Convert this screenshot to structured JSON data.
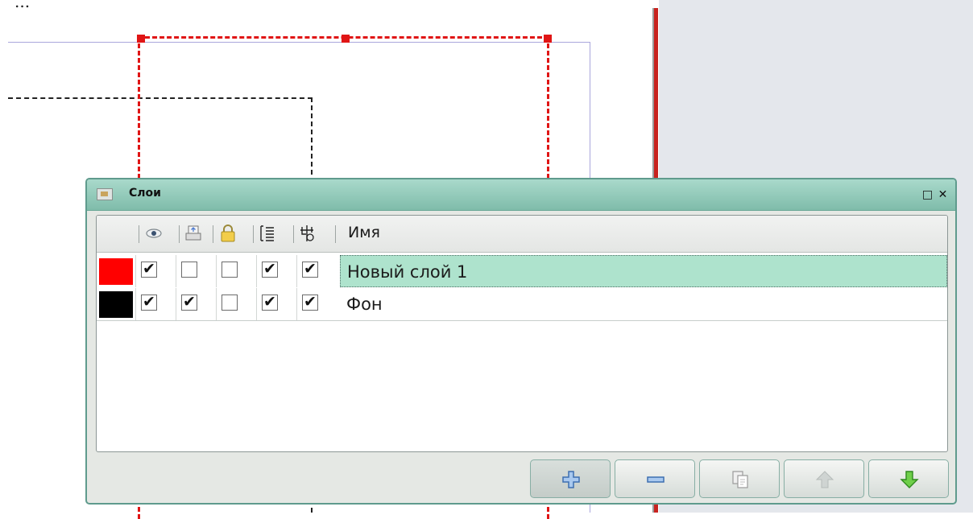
{
  "background_text": "...",
  "dialog": {
    "title": "Слои",
    "restore_glyph": "□",
    "close_glyph": "✕",
    "columns": {
      "icons": [
        "eye-icon",
        "print-icon",
        "lock-icon",
        "flow-icon",
        "outline-icon"
      ],
      "name_header": "Имя"
    },
    "layers": [
      {
        "color": "#ff0000",
        "visible": true,
        "printable": false,
        "locked": false,
        "flow": true,
        "outline": true,
        "name": "Новый слой 1",
        "selected": true
      },
      {
        "color": "#000000",
        "visible": true,
        "printable": true,
        "locked": false,
        "flow": true,
        "outline": true,
        "name": "Фон",
        "selected": false
      }
    ],
    "check_glyph": "✔",
    "toolbar": [
      "add-layer-icon",
      "remove-layer-icon",
      "duplicate-layer-icon",
      "raise-layer-icon",
      "lower-layer-icon"
    ]
  },
  "colors": {
    "accent": "#7fbcaa",
    "selection": "#aee3cd",
    "guide_red": "#e01515"
  }
}
